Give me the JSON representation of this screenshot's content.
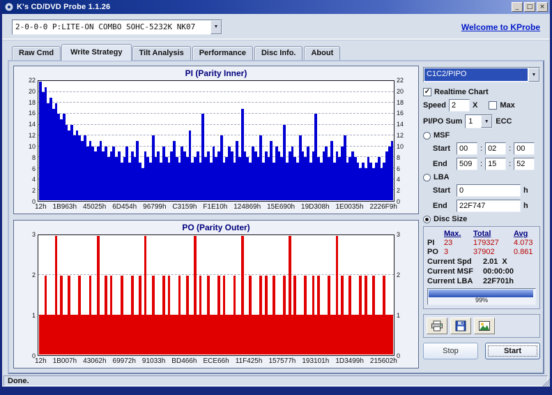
{
  "titlebar": {
    "title": "K's CD/DVD Probe 1.1.26"
  },
  "toolbar": {
    "device": "2-0-0-0 P:LITE-ON COMBO SOHC-5232K NK07",
    "welcome": "Welcome to KProbe"
  },
  "tabs": [
    {
      "label": "Raw Cmd"
    },
    {
      "label": "Write Strategy"
    },
    {
      "label": "Tilt Analysis"
    },
    {
      "label": "Performance"
    },
    {
      "label": "Disc Info."
    },
    {
      "label": "About"
    }
  ],
  "chart_data": [
    {
      "type": "bar",
      "title": "PI (Parity Inner)",
      "ylim": [
        0,
        22
      ],
      "ytick_step": 2,
      "bar_color": "#0000d2",
      "grid": "dashed-horizontal",
      "x_labels": [
        "12h",
        "1B963h",
        "45025h",
        "6D454h",
        "96799h",
        "C3159h",
        "F1E10h",
        "124869h",
        "15E690h",
        "19D308h",
        "1E0035h",
        "2226F9h"
      ],
      "values": [
        22,
        20,
        21,
        18,
        19,
        17,
        18,
        16,
        15,
        16,
        14,
        13,
        14,
        12,
        13,
        12,
        11,
        12,
        10,
        11,
        10,
        9,
        10,
        11,
        9,
        10,
        8,
        9,
        10,
        8,
        9,
        7,
        8,
        10,
        7,
        9,
        8,
        11,
        7,
        6,
        9,
        8,
        7,
        12,
        8,
        9,
        7,
        10,
        8,
        7,
        9,
        11,
        8,
        7,
        10,
        9,
        8,
        13,
        7,
        8,
        9,
        7,
        16,
        8,
        9,
        7,
        10,
        8,
        9,
        12,
        7,
        8,
        10,
        9,
        7,
        11,
        8,
        17,
        9,
        8,
        7,
        10,
        9,
        8,
        12,
        7,
        9,
        8,
        11,
        7,
        10,
        9,
        8,
        14,
        7,
        9,
        10,
        8,
        7,
        12,
        9,
        8,
        10,
        7,
        9,
        16,
        8,
        7,
        9,
        10,
        8,
        11,
        7,
        9,
        8,
        10,
        12,
        7,
        8,
        9,
        8,
        7,
        6,
        7,
        6,
        8,
        7,
        6,
        7,
        8,
        6,
        7,
        9,
        10,
        11
      ]
    },
    {
      "type": "bar",
      "title": "PO (Parity Outer)",
      "ylim": [
        0,
        3
      ],
      "ytick_step": 1,
      "bar_color": "#e10000",
      "grid": "dashed-horizontal",
      "x_labels": [
        "12h",
        "1B007h",
        "43062h",
        "69972h",
        "91033h",
        "BD466h",
        "ECE66h",
        "11F425h",
        "157577h",
        "193101h",
        "1D3499h",
        "215602h"
      ],
      "values": [
        1,
        1,
        2,
        1,
        1,
        1,
        3,
        1,
        2,
        1,
        1,
        2,
        1,
        1,
        1,
        2,
        1,
        1,
        1,
        2,
        1,
        1,
        3,
        1,
        1,
        2,
        1,
        2,
        1,
        1,
        1,
        2,
        1,
        1,
        1,
        2,
        1,
        1,
        2,
        1,
        3,
        1,
        1,
        2,
        1,
        1,
        1,
        2,
        1,
        2,
        1,
        1,
        1,
        2,
        1,
        1,
        2,
        1,
        1,
        3,
        1,
        2,
        1,
        1,
        2,
        1,
        1,
        1,
        2,
        1,
        2,
        1,
        1,
        1,
        2,
        1,
        1,
        3,
        1,
        1,
        2,
        1,
        1,
        1,
        2,
        1,
        2,
        1,
        1,
        2,
        1,
        1,
        1,
        2,
        1,
        3,
        1,
        2,
        1,
        1,
        1,
        2,
        1,
        1,
        2,
        1,
        2,
        1,
        1,
        1,
        2,
        1,
        1,
        3,
        1,
        2,
        1,
        1,
        2,
        1,
        1,
        1,
        2,
        1,
        2,
        1,
        1,
        2,
        1,
        1,
        1,
        2,
        1,
        1,
        1
      ]
    }
  ],
  "side": {
    "mode": "C1C2/PIPO",
    "realtime": "Realtime Chart",
    "speed_label": "Speed",
    "speed_value": "2",
    "speed_x": "X",
    "max_label": "Max",
    "sum_label": "PI/PO Sum",
    "sum_value": "1",
    "ecc": "ECC",
    "msf_label": "MSF",
    "start_label": "Start",
    "end_label": "End",
    "msf_start": [
      "00",
      "02",
      "00"
    ],
    "msf_end": [
      "509",
      "15",
      "52"
    ],
    "lba_label": "LBA",
    "lba_start": "0",
    "lba_end": "22F747",
    "hour_unit": "h",
    "disc_size": "Disc Size",
    "stats_headers": [
      "Max.",
      "Total",
      "Avg"
    ],
    "stats": [
      {
        "name": "PI",
        "max": "23",
        "total": "179327",
        "avg": "4.073"
      },
      {
        "name": "PO",
        "max": "3",
        "total": "37902",
        "avg": "0.861"
      }
    ],
    "current_spd_label": "Current Spd",
    "current_spd": "2.01",
    "current_spd_unit": "X",
    "current_msf_label": "Current MSF",
    "current_msf": "00:00:00",
    "current_lba_label": "Current LBA",
    "current_lba": "22F701h",
    "progress_percent": 99,
    "progress_text": "99%",
    "stop": "Stop",
    "start": "Start"
  },
  "statusbar": {
    "text": "Done."
  }
}
